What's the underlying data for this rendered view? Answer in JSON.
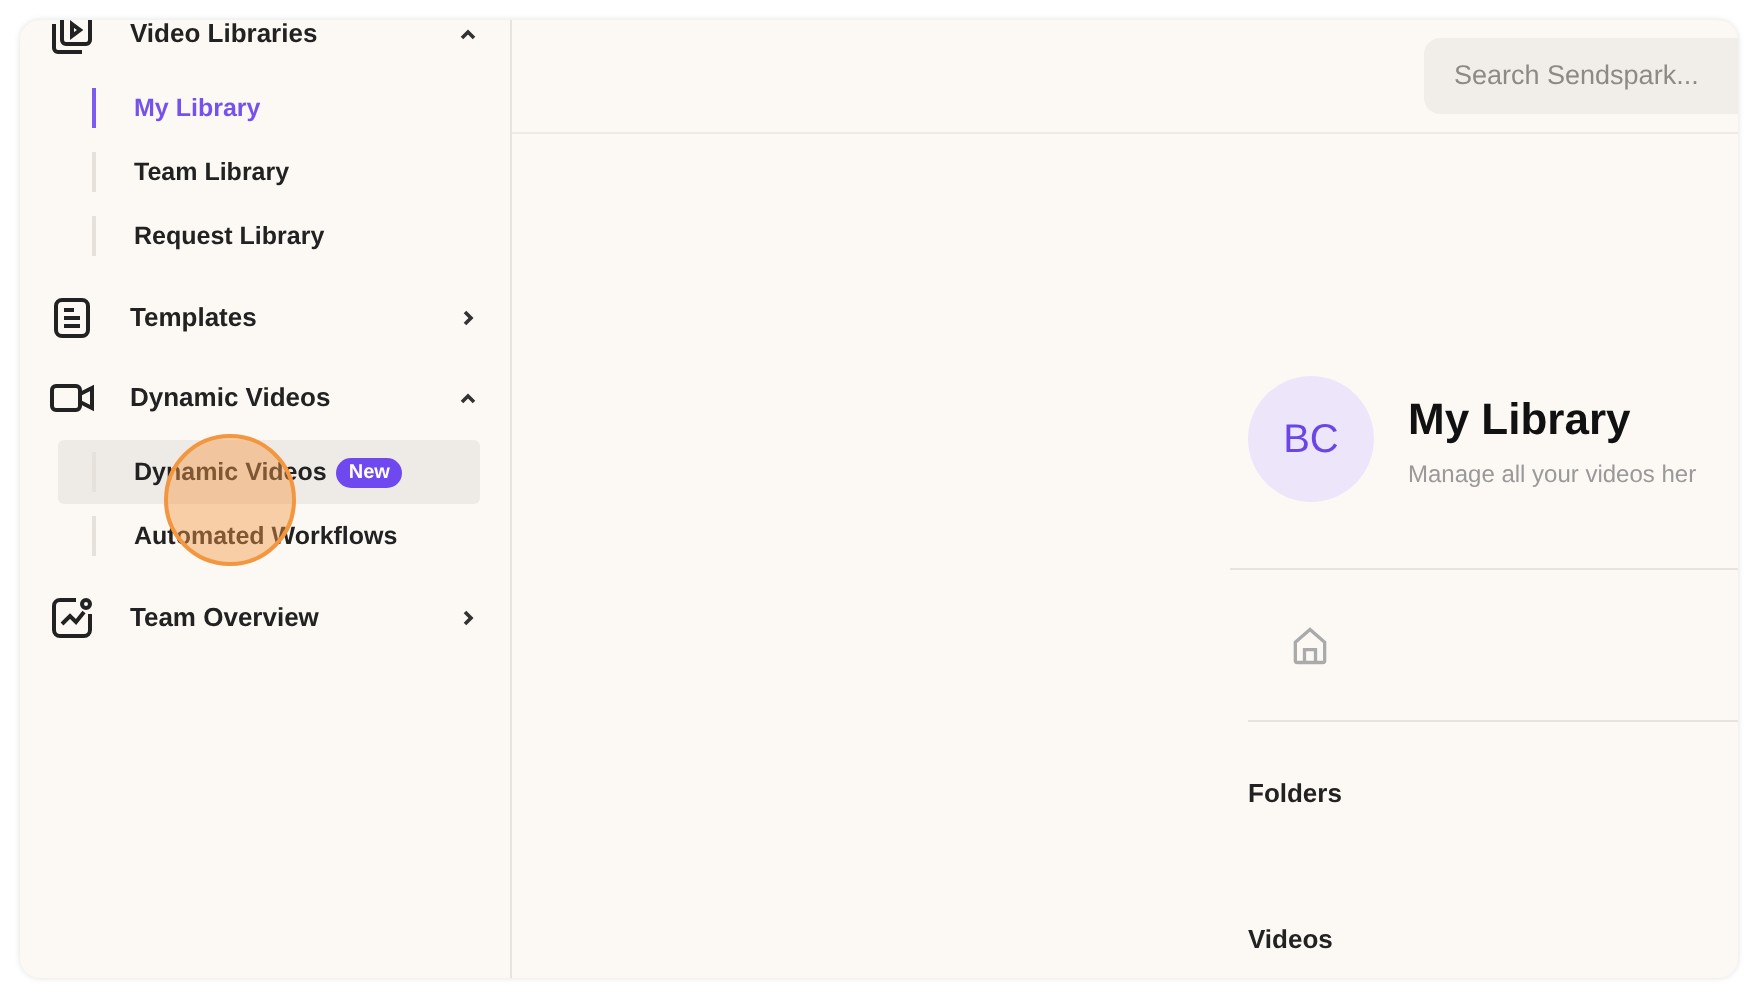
{
  "sidebar": {
    "sections": [
      {
        "label": "Video Libraries",
        "kind": "library",
        "expanded": true,
        "children": [
          {
            "label": "My Library",
            "selected": true
          },
          {
            "label": "Team Library",
            "selected": false
          },
          {
            "label": "Request Library",
            "selected": false
          }
        ]
      },
      {
        "label": "Templates",
        "kind": "templates",
        "expanded": false
      },
      {
        "label": "Dynamic Videos",
        "kind": "video",
        "expanded": true,
        "children": [
          {
            "label": "Dynamic Videos",
            "selected": false,
            "hovered": true,
            "badge": "New"
          },
          {
            "label": "Automated Workflows",
            "selected": false
          }
        ]
      },
      {
        "label": "Team Overview",
        "kind": "overview",
        "expanded": false
      }
    ]
  },
  "search": {
    "placeholder": "Search Sendspark..."
  },
  "library": {
    "avatar": "BC",
    "title": "My Library",
    "subtitle": "Manage all your videos her",
    "folders_heading": "Folders",
    "videos_heading": "Videos"
  }
}
